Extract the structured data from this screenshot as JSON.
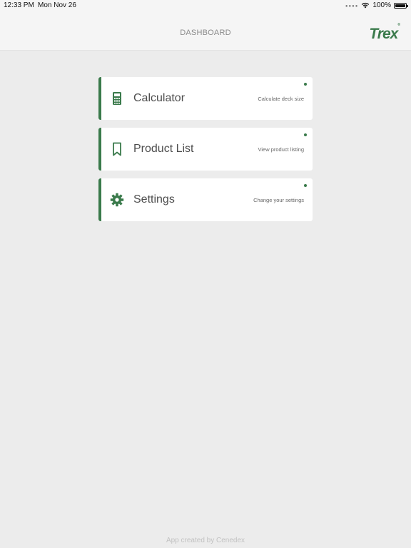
{
  "status_bar": {
    "time": "12:33 PM",
    "date": "Mon Nov 26",
    "battery": "100%"
  },
  "nav": {
    "title": "DASHBOARD",
    "logo": "Trex",
    "logo_mark": "®"
  },
  "cards": [
    {
      "label": "Calculator",
      "description": "Calculate deck size",
      "icon": "calculator-icon"
    },
    {
      "label": "Product List",
      "description": "View product listing",
      "icon": "bookmark-icon"
    },
    {
      "label": "Settings",
      "description": "Change your settings",
      "icon": "gear-icon"
    }
  ],
  "footer": "App created by Cenedex",
  "colors": {
    "accent": "#3a7a4b",
    "background": "#ececec",
    "card": "#ffffff"
  }
}
